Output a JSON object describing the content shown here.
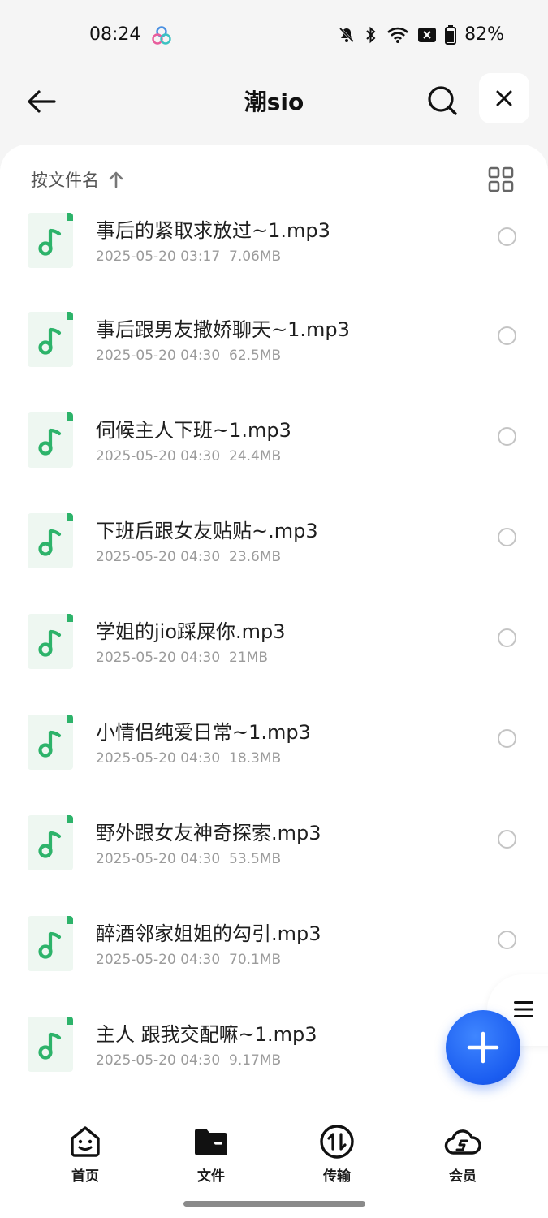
{
  "status_bar": {
    "time": "08:24",
    "battery": "82%"
  },
  "header": {
    "title": "潮sio"
  },
  "sort": {
    "label": "按文件名"
  },
  "files": [
    {
      "name": "事后的紧取求放过~1.mp3",
      "date": "2025-05-20 03:17",
      "size": "7.06MB"
    },
    {
      "name": "事后跟男友撒娇聊天~1.mp3",
      "date": "2025-05-20 04:30",
      "size": "62.5MB"
    },
    {
      "name": "伺候主人下班~1.mp3",
      "date": "2025-05-20 04:30",
      "size": "24.4MB"
    },
    {
      "name": "下班后跟女友贴贴~.mp3",
      "date": "2025-05-20 04:30",
      "size": "23.6MB"
    },
    {
      "name": "学姐的jio踩屎你.mp3",
      "date": "2025-05-20 04:30",
      "size": "21MB"
    },
    {
      "name": "小情侣纯爱日常~1.mp3",
      "date": "2025-05-20 04:30",
      "size": "18.3MB"
    },
    {
      "name": "野外跟女友神奇探索.mp3",
      "date": "2025-05-20 04:30",
      "size": "53.5MB"
    },
    {
      "name": "醉酒邻家姐姐的勾引.mp3",
      "date": "2025-05-20 04:30",
      "size": "70.1MB"
    },
    {
      "name": "主人 跟我交配嘛~1.mp3",
      "date": "2025-05-20 04:30",
      "size": "9.17MB"
    }
  ],
  "bottom_nav": [
    {
      "label": "首页",
      "icon": "home-face-icon"
    },
    {
      "label": "文件",
      "icon": "folder-icon",
      "active": true
    },
    {
      "label": "传输",
      "icon": "transfer-icon"
    },
    {
      "label": "会员",
      "icon": "vip-cloud-icon"
    }
  ],
  "colors": {
    "accent": "#1a5cf0",
    "music_icon": "#2db36a",
    "icon_bg": "#eef7f1"
  }
}
